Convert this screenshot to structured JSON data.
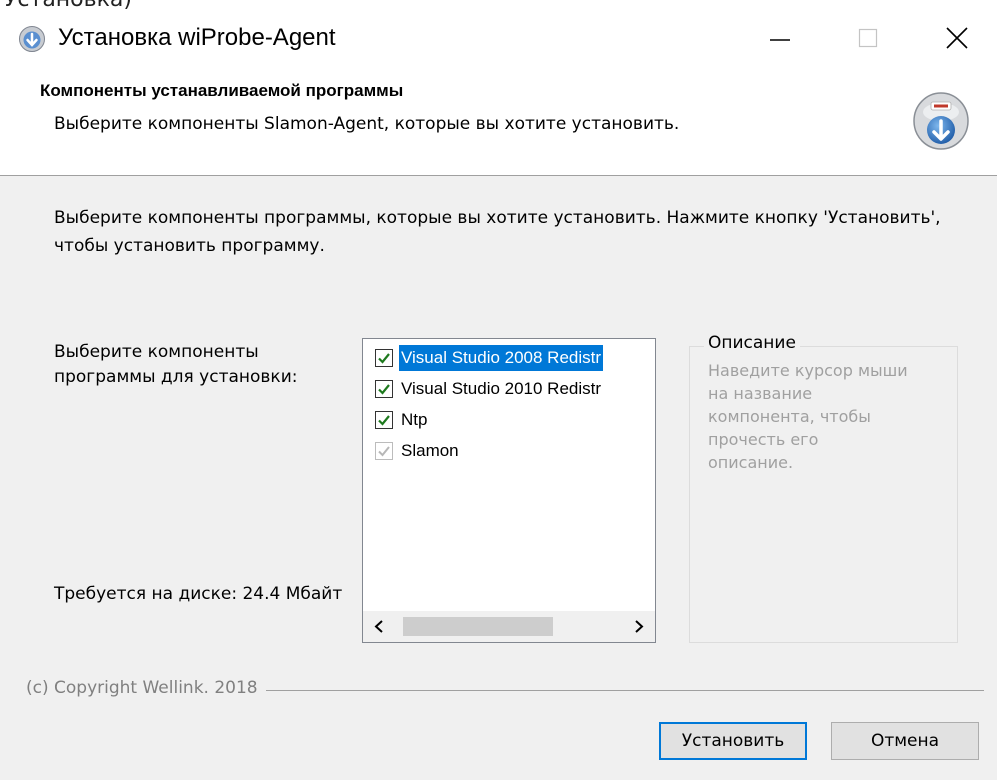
{
  "top_strip": {
    "cut_text": "Установка)"
  },
  "window": {
    "title": "Установка wiProbe-Agent",
    "controls": {
      "minimize": "minimize",
      "maximize": "maximize",
      "close": "close"
    }
  },
  "header": {
    "title": "Компоненты устанавливаемой программы",
    "subtitle": "Выберите компоненты Slamon-Agent, которые вы хотите установить."
  },
  "intro": "Выберите компоненты программы, которые вы хотите установить. Нажмите кнопку 'Установить', чтобы установить программу.",
  "select_label": "Выберите компоненты программы для установки:",
  "components": [
    {
      "label": "Visual Studio 2008 Redistr",
      "checked": true,
      "selected": true,
      "disabled": false
    },
    {
      "label": "Visual Studio 2010 Redistr",
      "checked": true,
      "selected": false,
      "disabled": false
    },
    {
      "label": "Ntp",
      "checked": true,
      "selected": false,
      "disabled": false
    },
    {
      "label": "Slamon",
      "checked": true,
      "selected": false,
      "disabled": true
    }
  ],
  "disk_space": "Требуется на диске: 24.4 Мбайт",
  "description": {
    "legend": "Описание",
    "text": "Наведите курсор мыши на название компонента, чтобы прочесть его описание."
  },
  "copyright": "(c) Copyright Wellink. 2018",
  "buttons": {
    "install": "Установить",
    "cancel": "Отмена"
  },
  "colors": {
    "selection": "#0078d7",
    "check": "#1e7a1e",
    "disabled_text": "#a0a0a0"
  }
}
